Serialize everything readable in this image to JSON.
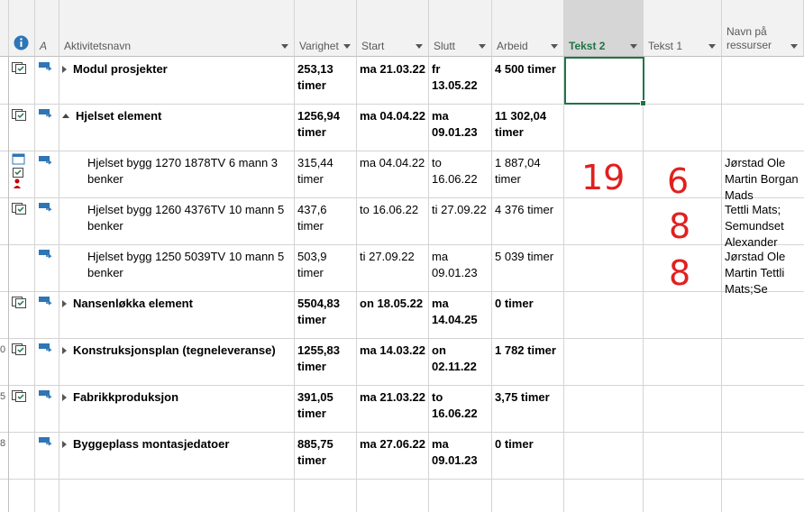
{
  "columns": {
    "indicators_icon": "info-icon",
    "mode_short": "A",
    "name": "Aktivitetsnavn",
    "duration": "Varighet",
    "start": "Start",
    "finish": "Slutt",
    "work": "Arbeid",
    "text2": "Tekst 2",
    "text1": "Tekst 1",
    "resources": "Navn på ressurser"
  },
  "rows": [
    {
      "name": "Modul prosjekter",
      "bold": true,
      "expanded": false,
      "indent": 0,
      "duration": "253,13 timer",
      "start": "ma 21.03.22",
      "finish": "fr 13.05.22",
      "work": "4 500 timer",
      "resources": "",
      "rownum": ""
    },
    {
      "name": "Hjelset element",
      "bold": true,
      "expanded": true,
      "indent": 0,
      "duration": "1256,94 timer",
      "start": "ma 04.04.22",
      "finish": "ma 09.01.23",
      "work": "11 302,04 timer",
      "resources": "",
      "rownum": ""
    },
    {
      "name": "Hjelset bygg 1270 1878TV 6 mann 3 benker",
      "bold": false,
      "expanded": null,
      "indent": 1,
      "duration": "315,44 timer",
      "start": "ma 04.04.22",
      "finish": "to 16.06.22",
      "work": "1 887,04 timer",
      "resources": "Jørstad Ole Martin Borgan Mads",
      "rownum": ""
    },
    {
      "name": "Hjelset bygg 1260 4376TV 10 mann 5 benker",
      "bold": false,
      "expanded": null,
      "indent": 1,
      "duration": "437,6 timer",
      "start": "to 16.06.22",
      "finish": "ti 27.09.22",
      "work": "4 376 timer",
      "resources": "Tettli Mats; Semundset Alexander",
      "rownum": ""
    },
    {
      "name": "Hjelset bygg 1250 5039TV  10 mann 5 benker",
      "bold": false,
      "expanded": null,
      "indent": 1,
      "duration": "503,9 timer",
      "start": "ti 27.09.22",
      "finish": "ma 09.01.23",
      "work": "5 039 timer",
      "resources": "Jørstad Ole Martin Tettli Mats;Se",
      "rownum": ""
    },
    {
      "name": "Nansenløkka element",
      "bold": true,
      "expanded": false,
      "indent": 0,
      "duration": "5504,83 timer",
      "start": "on 18.05.22",
      "finish": "ma 14.04.25",
      "work": "0 timer",
      "resources": "",
      "rownum": ""
    },
    {
      "name": "Konstruksjonsplan (tegneleveranse)",
      "bold": true,
      "expanded": false,
      "indent": 0,
      "duration": "1255,83 timer",
      "start": "ma 14.03.22",
      "finish": "on 02.11.22",
      "work": "1 782 timer",
      "resources": "",
      "rownum": "0"
    },
    {
      "name": "Fabrikkproduksjon",
      "bold": true,
      "expanded": false,
      "indent": 0,
      "duration": "391,05 timer",
      "start": "ma 21.03.22",
      "finish": "to 16.06.22",
      "work": "3,75 timer",
      "resources": "",
      "rownum": "5"
    },
    {
      "name": "Byggeplass montasjedatoer",
      "bold": true,
      "expanded": false,
      "indent": 0,
      "duration": "885,75 timer",
      "start": "ma 27.06.22",
      "finish": "ma 09.01.23",
      "work": "0 timer",
      "resources": "",
      "rownum": "8"
    }
  ],
  "handwriting": {
    "row3_text2": "19",
    "row3_text1": "6",
    "row4_text1": "8",
    "row5_text1": "8",
    "color": "#e02020"
  },
  "colors": {
    "accent": "#217346",
    "header_bg": "#f2f2f2",
    "active_header_bg": "#d6d6d6",
    "info": "#2e75b6"
  }
}
